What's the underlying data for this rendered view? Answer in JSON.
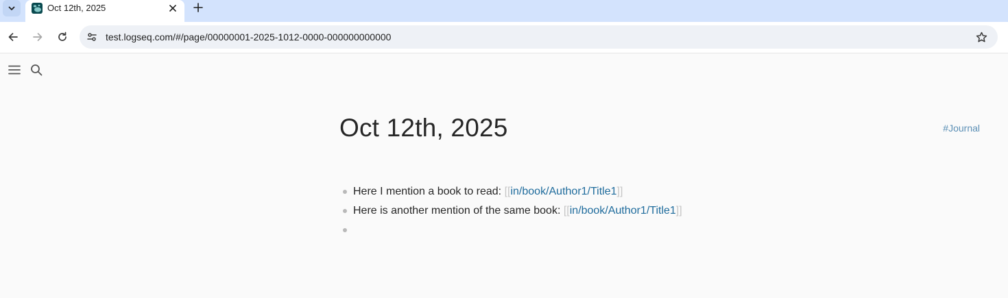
{
  "browser": {
    "tab": {
      "title": "Oct 12th, 2025"
    },
    "address_bar": {
      "url": "test.logseq.com/#/page/00000001-2025-1012-0000-000000000000"
    }
  },
  "page": {
    "title": "Oct 12th, 2025",
    "tag": "#Journal"
  },
  "blocks": [
    {
      "text": "Here I mention a book to read: ",
      "bracket_open": "[[",
      "ref": "in/book/Author1/Title1",
      "bracket_close": "]]"
    },
    {
      "text": "Here is another mention of the same book: ",
      "bracket_open": "[[",
      "ref": "in/book/Author1/Title1",
      "bracket_close": "]]"
    },
    {
      "text": ""
    }
  ],
  "icons": {
    "tab_menu": "chevron-down-icon",
    "tab_close": "close-icon",
    "new_tab": "plus-icon",
    "back": "arrow-left-icon",
    "forward": "arrow-right-icon",
    "reload": "reload-icon",
    "site_info": "tune-icon",
    "bookmark": "star-icon",
    "app_menu": "hamburger-icon",
    "app_search": "search-icon"
  },
  "colors": {
    "tabstrip": "#d3e3fd",
    "omnibox": "#eef1f6",
    "page_bg": "#fafafa",
    "link": "#1e6b9c",
    "tag": "#5b8fb5",
    "bracket": "#c6c6c6"
  }
}
